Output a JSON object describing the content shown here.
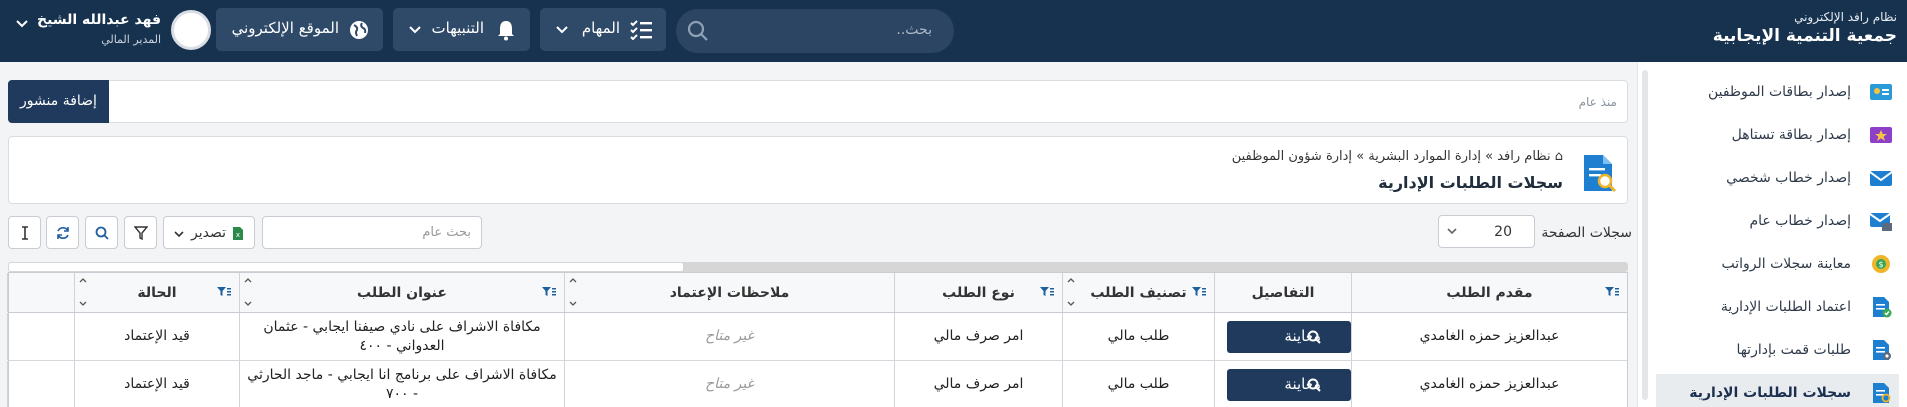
{
  "app": {
    "system_name": "نظام رافد الإلكتروني",
    "org_name": "جمعية التنمية الإيجابية"
  },
  "header": {
    "search_placeholder": "بحث..",
    "tasks_label": "المهام",
    "alerts_label": "التنبيهات",
    "website_label": "الموقع الإلكتروني",
    "user_name": "فهد عبدالله الشيخ",
    "user_role": "المدير المالي"
  },
  "sidebar": {
    "items": [
      {
        "label": "إصدار بطاقات الموظفين",
        "icon": "id-card-icon"
      },
      {
        "label": "إصدار بطاقة تستاهل",
        "icon": "star-card-icon"
      },
      {
        "label": "إصدار خطاب شخصي",
        "icon": "envelope-icon"
      },
      {
        "label": "إصدار خطاب عام",
        "icon": "envelope-print-icon"
      },
      {
        "label": "معاينة سجلات الرواتب",
        "icon": "money-gear-icon"
      },
      {
        "label": "اعتماد الطلبات الإدارية",
        "icon": "doc-check-icon"
      },
      {
        "label": "طلبات قمت بإدارتها",
        "icon": "doc-gear-icon"
      },
      {
        "label": "سجلات الطلبات الإدارية",
        "icon": "doc-search-icon"
      }
    ]
  },
  "postbar": {
    "since_text": "منذ عام",
    "add_post_label": "إضافة منشور"
  },
  "breadcrumb": {
    "items": [
      "نظام رافد",
      "إدارة الموارد البشرية",
      "إدارة شؤون الموظفين"
    ],
    "page_title": "سجلات الطلبات الإدارية"
  },
  "toolbar": {
    "per_page_label": "سجلات الصفحة",
    "per_page_value": "20",
    "search_placeholder": "بحث عام",
    "export_label": "تصدير"
  },
  "table": {
    "columns": [
      "مقدم الطلب",
      "التفاصيل",
      "تصنيف الطلب",
      "نوع الطلب",
      "ملاحظات الإعتماد",
      "عنوان الطلب",
      "الحالة"
    ],
    "view_label": "معاينة",
    "rows": [
      {
        "applicant": "عبدالعزيز حمزه الغامدي",
        "category": "طلب مالي",
        "type": "امر صرف مالي",
        "notes": "غير متاح",
        "title": "مكافاة الاشراف على نادي صيفنا ايجابي - عثمان العدواني - ٤٠٠",
        "status": "قيد الإعتماد"
      },
      {
        "applicant": "عبدالعزيز حمزه الغامدي",
        "category": "طلب مالي",
        "type": "امر صرف مالي",
        "notes": "غير متاح",
        "title": "مكافاة الاشراف على برنامج انا ايجابي - ماجد الحارثي - ٧٠٠",
        "status": "قيد الإعتماد"
      }
    ]
  }
}
